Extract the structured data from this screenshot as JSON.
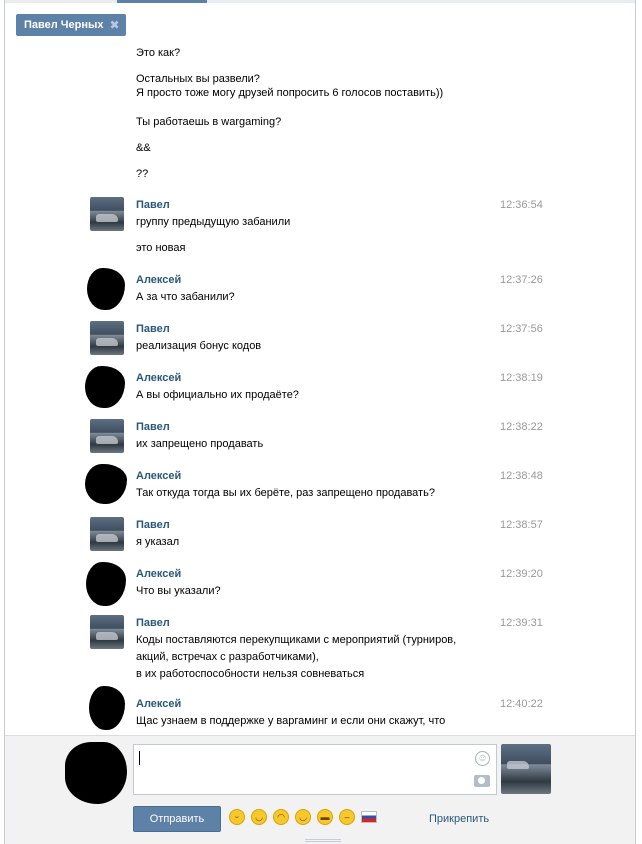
{
  "tab": {
    "label": "Павел Черных",
    "close_glyph": "✖"
  },
  "early_lines": [
    "Это как?",
    "Остальных вы развели?",
    "Я просто тоже могу друзей попросить 6 голосов поставить))",
    "Ты работаешь в wargaming?",
    "&&",
    "??"
  ],
  "messages": [
    {
      "author": "Павел",
      "time": "12:36:54",
      "avatar": "car-photo",
      "lines": [
        "группу предыдущую забанили",
        "это новая"
      ]
    },
    {
      "author": "Алексей",
      "time": "12:37:26",
      "avatar": "redacted-blob",
      "lines": [
        "А за что забанили?"
      ]
    },
    {
      "author": "Павел",
      "time": "12:37:56",
      "avatar": "car-photo",
      "lines": [
        "реализация бонус кодов"
      ]
    },
    {
      "author": "Алексей",
      "time": "12:38:19",
      "avatar": "redacted-blob",
      "lines": [
        "А вы официально их продаёте?"
      ]
    },
    {
      "author": "Павел",
      "time": "12:38:22",
      "avatar": "car-photo",
      "lines": [
        "их запрещено продавать"
      ]
    },
    {
      "author": "Алексей",
      "time": "12:38:48",
      "avatar": "redacted-blob",
      "lines": [
        "Так откуда тогда вы их берёте, раз запрещено продавать?"
      ]
    },
    {
      "author": "Павел",
      "time": "12:38:57",
      "avatar": "car-photo",
      "lines": [
        "я указал"
      ]
    },
    {
      "author": "Алексей",
      "time": "12:39:20",
      "avatar": "redacted-blob",
      "lines": [
        "Что вы указали?"
      ]
    },
    {
      "author": "Павел",
      "time": "12:39:31",
      "avatar": "car-photo",
      "lines": [
        "Коды поставляются перекупщиками с мероприятий (турниров,",
        "акций, встречах с разработчиками),",
        "в их работоспособности нельзя совневаться"
      ]
    },
    {
      "author": "Алексей",
      "time": "12:40:22",
      "avatar": "redacted-blob",
      "lines": [
        "Щас узнаем в поддержке у варгаминг и если они скажут, что"
      ]
    }
  ],
  "composer": {
    "input_value": "",
    "send_label": "Отправить",
    "attach_label": "Прикрепить",
    "smile_icon": "smile-icon",
    "camera_icon": "camera-icon",
    "emoji_icons": [
      "laughing-emoji",
      "grinning-emoji",
      "blushing-emoji",
      "happy-emoji",
      "sunglasses-emoji",
      "neutral-emoji",
      "russia-flag"
    ]
  },
  "colors": {
    "accent": "#5e81a8",
    "author_name": "#2b587a",
    "timestamp": "#999999",
    "compose_bg": "#f2f2f2"
  }
}
